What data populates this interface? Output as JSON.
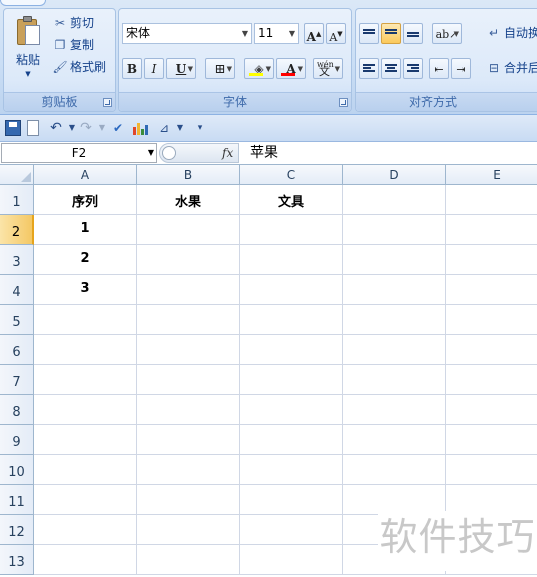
{
  "ribbon": {
    "clipboard": {
      "title": "剪贴板",
      "paste_label": "粘贴",
      "cut_label": "剪切",
      "copy_label": "复制",
      "format_painter_label": "格式刷"
    },
    "font": {
      "title": "字体",
      "font_name": "宋体",
      "font_size": "11",
      "grow_font": "A",
      "shrink_font": "A",
      "bold": "B",
      "italic": "I",
      "underline": "U",
      "font_color_letter": "A",
      "phonetic_top": "wén",
      "phonetic_char": "文"
    },
    "alignment": {
      "title": "对齐方式",
      "wrap_text_label": "自动换",
      "merge_label": "合并后"
    }
  },
  "formula_bar": {
    "name_box": "F2",
    "fx": "fx",
    "content": "苹果"
  },
  "sheet": {
    "columns": [
      "A",
      "B",
      "C",
      "D",
      "E"
    ],
    "rows": [
      "1",
      "2",
      "3",
      "4",
      "5",
      "6",
      "7",
      "8",
      "9",
      "10",
      "11",
      "12",
      "13"
    ],
    "cells": {
      "A1": "序列",
      "B1": "水果",
      "C1": "文具",
      "A2": "1",
      "A3": "2",
      "A4": "3"
    }
  },
  "watermark": "软件技巧",
  "colors": {
    "ribbon_bg": "#cadef5",
    "ribbon_text": "#15428b",
    "header_selected": "#f4c865",
    "gridline": "#d0d7e5"
  }
}
